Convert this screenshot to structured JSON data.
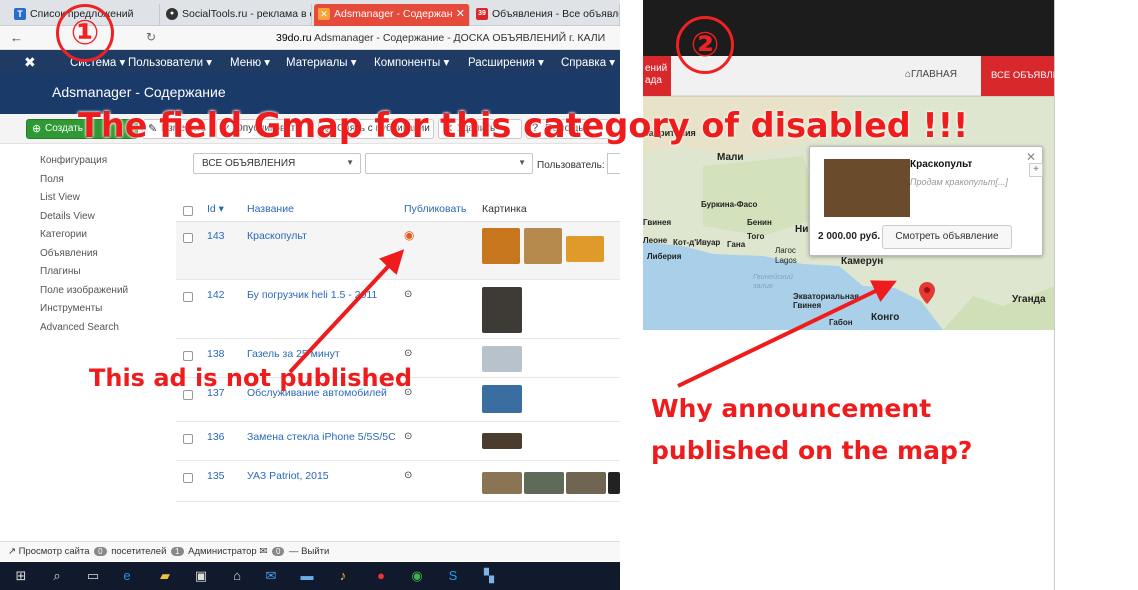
{
  "browser": {
    "tabs": [
      {
        "label": "Список предложений",
        "icon": "T"
      },
      {
        "label": "SocialTools.ru - реклама в с",
        "icon": "●"
      },
      {
        "label": "Adsmanager - Содержан",
        "icon": "✕"
      },
      {
        "label": "Объявления - Все объявле",
        "icon": "39"
      }
    ],
    "url_prefix": "39do.ru",
    "url_rest": " Adsmanager - Содержание - ДОСКА ОБЪЯВЛЕНИЙ г. КАЛИ"
  },
  "admin": {
    "menu": [
      "Система ▾",
      "Пользователи ▾",
      "Меню ▾",
      "Материалы ▾",
      "Компоненты ▾",
      "Расширения ▾",
      "Справка ▾"
    ],
    "page_title": "Adsmanager - Содержание",
    "toolbar": [
      "Создать",
      "Изменить",
      "Опубликовать",
      "Снять с публикации",
      "Удалить",
      "Помощь"
    ],
    "sidebar": [
      "Конфигурация",
      "Поля",
      "List View",
      "Details View",
      "Категории",
      "Объявления",
      "Плагины",
      "Поле изображений",
      "Инструменты",
      "Advanced Search"
    ],
    "filter_category": "ВСЕ ОБЪЯВЛЕНИЯ",
    "filter_user_label": "Пользователь:",
    "columns": {
      "id": "Id ▾",
      "title": "Название",
      "publish": "Публиковать",
      "image": "Картинка"
    },
    "rows": [
      {
        "id": "143",
        "title": "Краскопульт",
        "published": false
      },
      {
        "id": "142",
        "title": "Бу погрузчик heli 1.5 - 2011",
        "published": true
      },
      {
        "id": "138",
        "title": "Газель за 25 минут",
        "published": true
      },
      {
        "id": "137",
        "title": "Обслуживание автомобилей",
        "published": true
      },
      {
        "id": "136",
        "title": "Замена стекла iPhone 5/5S/5C",
        "published": true
      },
      {
        "id": "135",
        "title": "УАЗ Patriot, 2015",
        "published": true
      }
    ],
    "status_bar": {
      "view_site": "Просмотр сайта",
      "visitors_count": "0",
      "visitors": "посетителей",
      "admins_count": "1",
      "admins": "Администратор",
      "messages_count": "0",
      "logout": "— Выйти"
    }
  },
  "site": {
    "left_red_text": "ений\nада",
    "nav_home": "ГЛАВНАЯ",
    "nav_all": "ВСЕ ОБЪЯВЛЕ",
    "map_labels": [
      "Мали",
      "Буркина-Фасо",
      "Бенин",
      "Гвинея",
      "Леоне",
      "Кот-д'Ивуар",
      "Гана",
      "Того",
      "Либерия",
      "Лагос",
      "Lagos",
      "Гвинейский залив",
      "Экваториальная Гвинея",
      "Габон",
      "Конго",
      "Камерун",
      "Уганда",
      "Ни",
      "Мавритания"
    ],
    "popup": {
      "title": "Краскопульт",
      "desc": "Продам кракопульт[...]",
      "price": "2 000.00 руб.",
      "button": "Смотреть объявление"
    }
  },
  "annotations": {
    "num1": "①",
    "num2": "②",
    "headline": "The field Gmap for this category of disabled !!!",
    "left_note": "This ad is not published",
    "right_note_1": "Why announcement",
    "right_note_2": "published on the map?"
  },
  "colors": {
    "admin_navy": "#1f3b64",
    "accent_red": "#ee1c1c",
    "link_blue": "#2a69b8",
    "site_red": "#d9282c"
  }
}
